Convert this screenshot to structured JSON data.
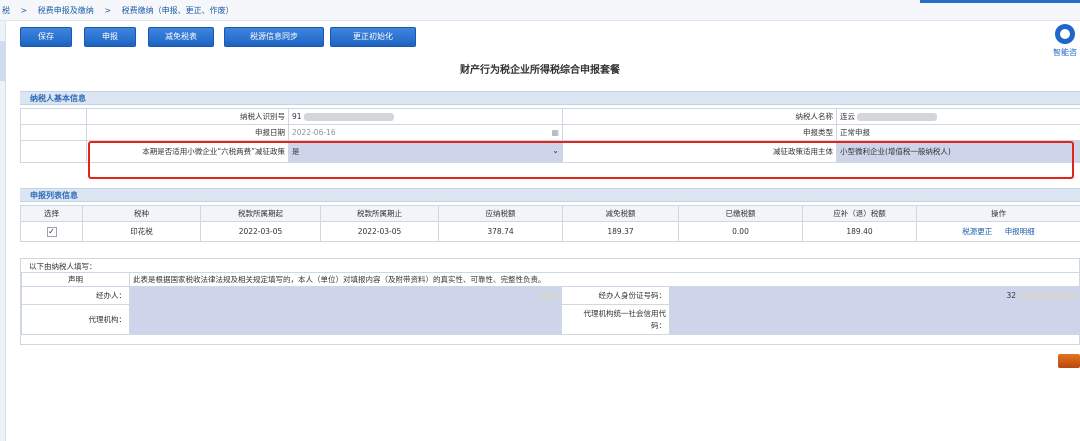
{
  "breadcrumb": {
    "items": [
      "税",
      ">",
      "税费申报及缴纳",
      ">",
      "税费缴纳（申报、更正、作废）"
    ]
  },
  "toolbar": {
    "buttons": [
      "保存",
      "申报",
      "减免税表",
      "税源信息同步",
      "更正初始化"
    ]
  },
  "helper": {
    "label": "智能咨"
  },
  "page_title": "财产行为税企业所得税综合申报套餐",
  "basic_info": {
    "section_title": "纳税人基本信息",
    "taxpayer_id_label": "纳税人识别号",
    "taxpayer_id_value": "91",
    "taxpayer_name_label": "纳税人名称",
    "taxpayer_name_value": "连云",
    "declare_date_label": "申报日期",
    "declare_date_value": "2022-06-16",
    "declare_type_label": "申报类型",
    "declare_type_value": "正常申报",
    "policy_label": "本期是否适用小微企业“六税两费”减征政策",
    "policy_value": "是",
    "subject_label": "减征政策适用主体",
    "subject_value": "小型微利企业(增值税一般纳税人)"
  },
  "declare_list": {
    "section_title": "申报列表信息",
    "headers": [
      "选择",
      "税种",
      "税款所属期起",
      "税款所属期止",
      "应纳税额",
      "减免税额",
      "已缴税额",
      "应补（退）税额",
      "操作"
    ],
    "rows": [
      {
        "check": "✓",
        "tax_type": "印花税",
        "period_start": "2022-03-05",
        "period_end": "2022-03-05",
        "payable": "378.74",
        "reduction": "189.37",
        "paid": "0.00",
        "refund": "189.40",
        "action1": "税源更正",
        "action2": "申报明细"
      }
    ]
  },
  "declaration": {
    "head": "以下由纳税人填写：",
    "statement_label": "声明",
    "statement_text": "此表是根据国家税收法律法规及相关规定填写的，本人（单位）对填报内容（及附带资料）的真实性、可靠性、完整性负责。",
    "agent_label": "经办人：",
    "agent_id_label": "经办人身份证号码：",
    "agent_id_value": "32",
    "agency_label": "代理机构：",
    "agency_code_label_1": "代理机构统一社会信用代",
    "agency_code_label_2": "码："
  }
}
